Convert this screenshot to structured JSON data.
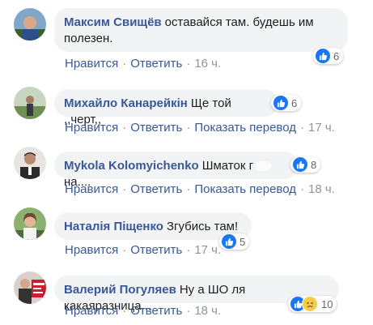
{
  "comments": [
    {
      "author": "Максим Свищёв",
      "text_line1": "оставайся там. будешь им",
      "text_line2": "полезен.",
      "reactions": {
        "count": "6",
        "types": [
          "like-icon"
        ]
      },
      "actions": {
        "like": "Нравится",
        "reply": "Ответить",
        "time": "16 ч."
      }
    },
    {
      "author": "Михайло Канарейкін",
      "text_line1": "Ще той ,,черт,,",
      "reactions": {
        "count": "6",
        "types": [
          "like-icon"
        ]
      },
      "actions": {
        "like": "Нравится",
        "reply": "Ответить",
        "translate": "Показать перевод",
        "time": "17 ч."
      }
    },
    {
      "author": "Mykola Kolomyichenko",
      "text_line1": "Шматок г",
      "text_line1b": "на....",
      "reactions": {
        "count": "8",
        "types": [
          "like-icon"
        ]
      },
      "actions": {
        "like": "Нравится",
        "reply": "Ответить",
        "translate": "Показать перевод",
        "time": "18 ч."
      }
    },
    {
      "author": "Наталія Піщенко",
      "text_line1": "Згубись там!",
      "reactions": {
        "count": "5",
        "types": [
          "like-icon"
        ]
      },
      "actions": {
        "like": "Нравится",
        "reply": "Ответить",
        "time": "17 ч."
      }
    },
    {
      "author": "Валерий Погуляев",
      "text_line1": "Ну а ШО ля какаяразница...",
      "reactions": {
        "count": "10",
        "types": [
          "like-icon",
          "sad-icon"
        ]
      },
      "actions": {
        "like": "Нравится",
        "reply": "Ответить",
        "time": "18 ч."
      }
    }
  ],
  "colors": {
    "author": "#385898",
    "bubble": "#f2f3f5",
    "like": "#1877f2",
    "meta": "#90949c"
  }
}
